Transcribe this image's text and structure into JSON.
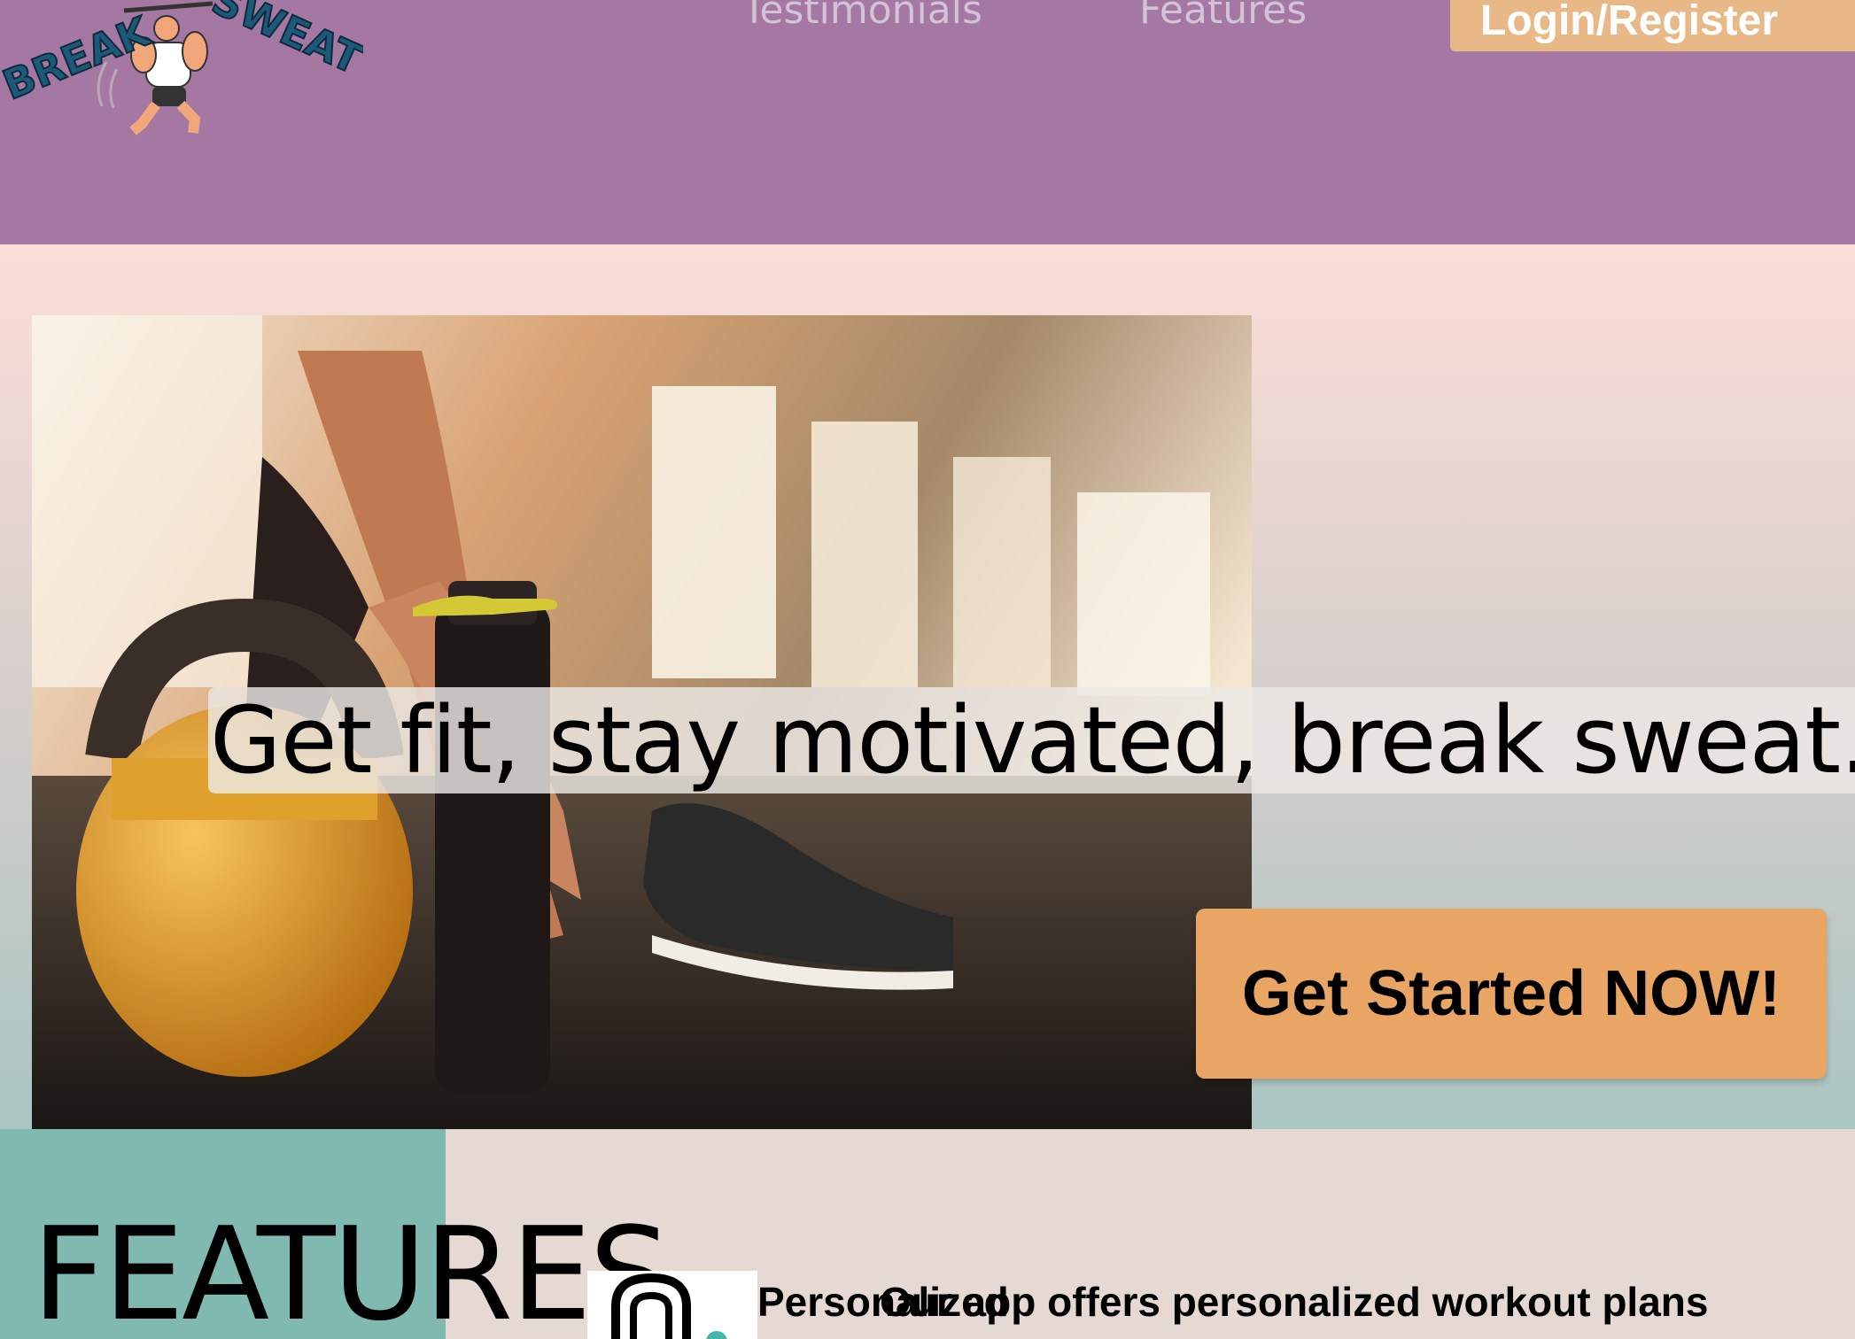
{
  "header": {
    "logo": {
      "text_top_left": "BREAK",
      "text_top_right": "SWEAT"
    },
    "nav": [
      {
        "label": "Testimonials"
      },
      {
        "label": "Features"
      }
    ],
    "login_label": "Login/Register"
  },
  "hero": {
    "tagline": "Get fit, stay motivated, break sweat.",
    "cta_label": "Get Started NOW!"
  },
  "features": {
    "title": "FEATURES",
    "items": [
      {
        "icon": "kettlebell-icon",
        "label": "Personalized",
        "description": "Our app offers personalized workout plans"
      }
    ]
  },
  "colors": {
    "header_bg": "#a577a3",
    "login_bg": "#e9b887",
    "cta_bg": "#e9a563",
    "features_teal": "#80b9b0",
    "features_bg": "#e6d9d3"
  }
}
